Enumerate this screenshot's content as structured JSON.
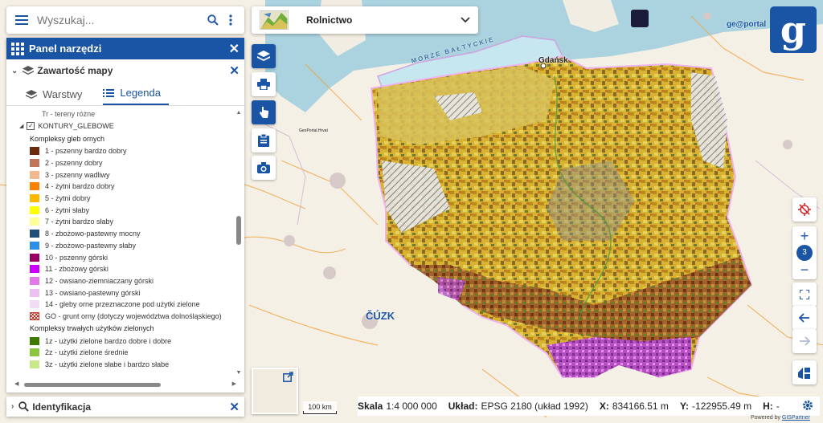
{
  "search": {
    "placeholder": "Wyszukaj..."
  },
  "panel": {
    "title": "Panel narzędzi",
    "section_title": "Zawartość mapy",
    "tabs": [
      "Warstwy",
      "Legenda"
    ],
    "legend_top_item": "Tr - tereny różne",
    "layer_name": "KONTURY_GLEBOWE",
    "group1_title": "Kompleksy gleb ornych",
    "group1_items": [
      {
        "label": "1 - pszenny bardzo dobry",
        "color": "#6b2a0e"
      },
      {
        "label": "2 - pszenny dobry",
        "color": "#c0765a"
      },
      {
        "label": "3 - pszenny wadliwy",
        "color": "#f2b88e"
      },
      {
        "label": "4 - żytni bardzo dobry",
        "color": "#ff7f00"
      },
      {
        "label": "5 - żytni dobry",
        "color": "#ffb800"
      },
      {
        "label": "6 - żytni słaby",
        "color": "#ffff00"
      },
      {
        "label": "7 - żytni bardzo słaby",
        "color": "#ffff99"
      },
      {
        "label": "8 - zbożowo-pastewny mocny",
        "color": "#1f4e79"
      },
      {
        "label": "9 - zbożowo-pastewny słaby",
        "color": "#2f8fe8"
      },
      {
        "label": "10 - pszenny górski",
        "color": "#990066"
      },
      {
        "label": "11 - zbożowy górski",
        "color": "#cc00ff"
      },
      {
        "label": "12 - owsiano-ziemniaczany górski",
        "color": "#e17ae6"
      },
      {
        "label": "13 - owsiano-pastewny górski",
        "color": "#eec0f2"
      },
      {
        "label": "14 - gleby orne przeznaczone pod użytki zielone",
        "color": "#f2dcf5"
      },
      {
        "label": "GO - grunt orny (dotyczy województwa dolnośląskiego)",
        "color": "hatch-red"
      }
    ],
    "group2_title": "Kompleksy trwałych użytków zielonych",
    "group2_items": [
      {
        "label": "1z - użytki zielone bardzo dobre i dobre",
        "color": "#3e7a00"
      },
      {
        "label": "2z - użytki zielone średnie",
        "color": "#8cc63f"
      },
      {
        "label": "3z - użytki zielone słabe i bardzo słabe",
        "color": "#c9e88a"
      }
    ]
  },
  "identify": {
    "title": "Identyfikacja"
  },
  "theme": {
    "label": "Rolnictwo"
  },
  "map_labels": {
    "gdansk": "Gdańsk",
    "baltic": "MORZE BAŁTYCKIE",
    "cuzk": "ČÚZK",
    "geoportal": "ge@portal",
    "sk_logo": "GeoPortal.Hrvat"
  },
  "logo_letter": "g",
  "zoom": {
    "level": "3"
  },
  "scalebar": {
    "label": "100 km"
  },
  "status": {
    "scale_label": "Skala",
    "scale_value": "1:4 000 000",
    "crs_label": "Układ:",
    "crs_value": "EPSG 2180 (układ 1992)",
    "x_label": "X:",
    "x_value": "834166.51 m",
    "y_label": "Y:",
    "y_value": "-122955.49 m",
    "h_label": "H:",
    "h_value": "-"
  },
  "powered": {
    "prefix": "Powered by",
    "link": "GISPartner"
  },
  "colors": {
    "accent": "#1a54a5"
  }
}
